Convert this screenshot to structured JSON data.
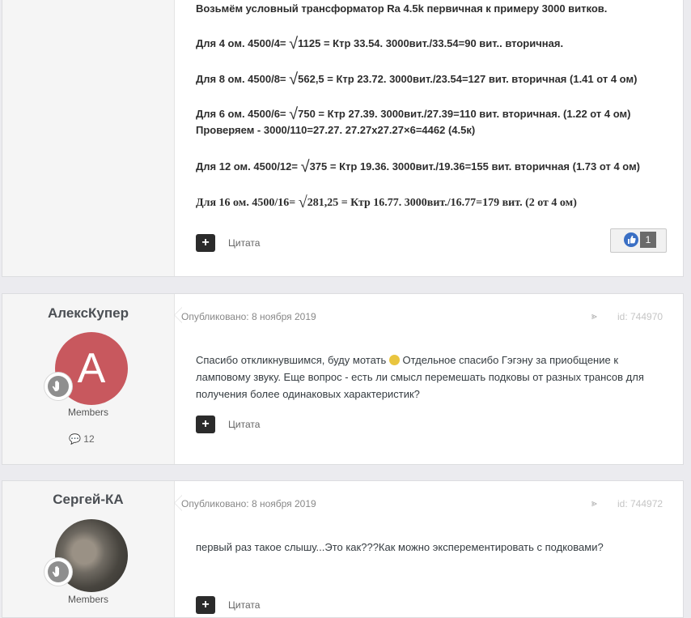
{
  "post1": {
    "lines": [
      "Возьмём условный трансформатор Ra 4.5k первичная к примеру 3000 витков.",
      "Для 4 ом. 4500/4= ",
      "1125 =  Ктр 33.54.  3000вит./33.54=90 вит.. вторичная.",
      "Для 8 ом. 4500/8= ",
      "562,5 = Ктр 23.72. 3000вит./23.54=127 вит. вторичная (1.41 от 4 ом)",
      "Для 6 ом. 4500/6= ",
      "750 = Ктр 27.39.  3000вит./27.39=110 вит. вторичная. (1.22 от 4 ом)",
      "Проверяем - 3000/110=27.27. 27.27x27.27×6=4462 (4.5к)",
      "Для 12 ом. 4500/12= ",
      "375 = Ктр 19.36. 3000вит./19.36=155 вит. вторичная (1.73 от 4 ом)",
      "Для 16 ом. 4500/16= ",
      "281,25 = Ктр 16.77. 3000вит./16.77=179 вит. (2 от 4 ом)"
    ],
    "sqrt_symbol": "√",
    "quote_label": "Цитата",
    "like_count": "1"
  },
  "post2": {
    "author": "АлексКупер",
    "avatar_letter": "A",
    "group": "Members",
    "post_count": "12",
    "published": "Опубликовано: 8 ноября 2019",
    "post_id": "id: 744970",
    "text_a": "Спасибо откликнувшимся, буду мотать",
    "text_b": "  Отдельное спасибо Гэгэну за приобщение к ламповому звуку. Еще вопрос - есть ли смысл перемешать подковы от разных трансов для получения более одинаковых характеристик?",
    "quote_label": "Цитата"
  },
  "post3": {
    "author": "Сергей-КА",
    "group": "Members",
    "published": "Опубликовано: 8 ноября 2019",
    "post_id": "id: 744972",
    "text": "первый раз такое слышу...Это как???Как можно эксперементировать с подковами?",
    "quote_label": "Цитата"
  }
}
